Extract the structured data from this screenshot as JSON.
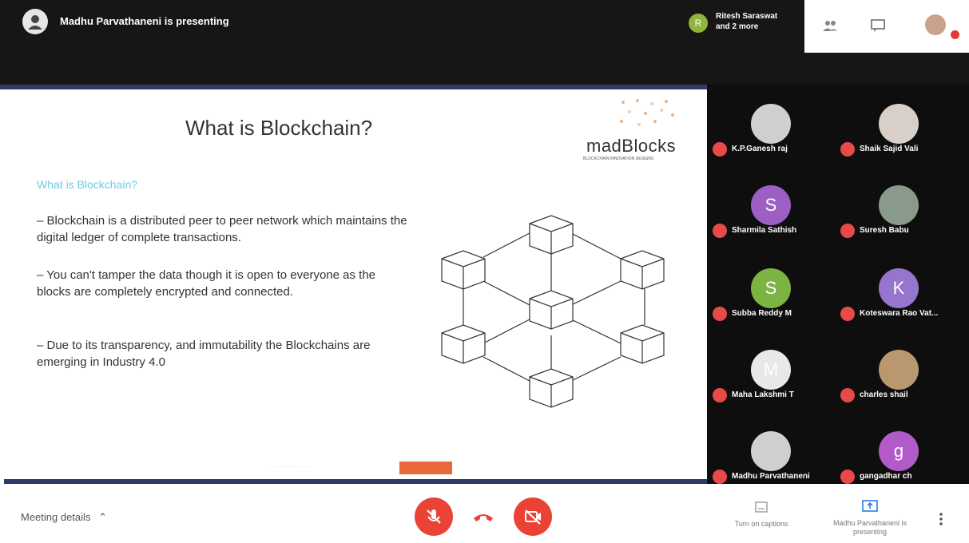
{
  "header": {
    "presenting_text": "Madhu Parvathaneni is presenting",
    "viewers_text": "Ritesh Saraswat and 2 more",
    "viewers_initial": "R"
  },
  "slide": {
    "title": "What is Blockchain?",
    "logo_text": "madBlocks",
    "logo_tagline": "BLOCKCHAIN INNOVATION DESIGNS",
    "subheading": "What is Blockchain?",
    "paragraphs": [
      "– Blockchain is a distributed peer to peer network which maintains the digital ledger of complete transactions.",
      "– You can't tamper the data though it is open to everyone as the blocks are completely encrypted and connected.",
      "– Due to its transparency, and immutability the Blockchains are emerging in Industry 4.0"
    ]
  },
  "participants": [
    {
      "name": "K.P.Ganesh raj",
      "initial": "",
      "color": "#cfcfcf"
    },
    {
      "name": "Shaik Sajid Vali",
      "initial": "",
      "color": "#d8d0c8"
    },
    {
      "name": "Sharmila Sathish",
      "initial": "S",
      "color": "#9c5fc4"
    },
    {
      "name": "Suresh Babu",
      "initial": "",
      "color": "#8a9a8a"
    },
    {
      "name": "Subba Reddy M",
      "initial": "S",
      "color": "#7cb342"
    },
    {
      "name": "Koteswara Rao Vat...",
      "initial": "K",
      "color": "#9575cd"
    },
    {
      "name": "Maha Lakshmi T",
      "initial": "M",
      "color": "#e8e8e8"
    },
    {
      "name": "charles shail",
      "initial": "",
      "color": "#b99870"
    },
    {
      "name": "Madhu Parvathaneni",
      "initial": "",
      "color": "#cfcfcf"
    },
    {
      "name": "gangadhar ch",
      "initial": "g",
      "color": "#b35ac9"
    }
  ],
  "bottom": {
    "meeting_details": "Meeting details",
    "captions_label": "Turn on captions",
    "presenting_label": "Madhu Parvathaneni is presenting"
  },
  "colors": {
    "accent_red": "#ea4335",
    "slide_border": "#2e3b66",
    "subheading": "#6ecbe6"
  }
}
